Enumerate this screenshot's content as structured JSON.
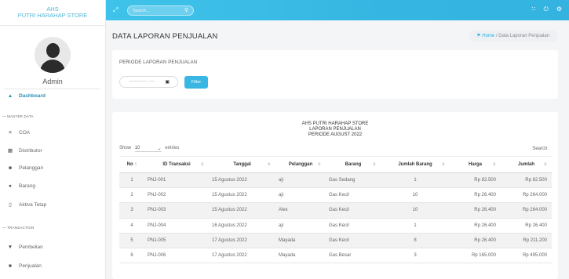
{
  "brand": {
    "line1": "AHS",
    "line2": "PUTRI HARAHAP STORE"
  },
  "user": {
    "name": "Admin"
  },
  "sidebar": {
    "dashboard": "Dashboard",
    "section_master": "MASTER DATA",
    "coa": "COA",
    "distributor": "Distributor",
    "pelanggan": "Pelanggan",
    "barang": "Barang",
    "aktiva": "Aktiva Tetap",
    "section_transaction": "TRANSACTION",
    "pembelian": "Pembelian",
    "penjualan": "Penjualan"
  },
  "topbar": {
    "search_placeholder": "Search..."
  },
  "page": {
    "title": "DATA LAPORAN PENJUALAN",
    "breadcrumb_home": "Home",
    "breadcrumb_sep": "/",
    "breadcrumb_current": "Data Laporan Penjualan"
  },
  "filter": {
    "label": "PERIODE LAPORAN PENJUALAN",
    "date_placeholder": "---------- ----",
    "button": "Filter"
  },
  "report": {
    "store": "AHS PUTRI HARAHAP STORE",
    "title": "LAPORAN PENJUALAN",
    "period": "PERIODE AUGUST 2022"
  },
  "table_controls": {
    "show": "Show",
    "entries_value": "10",
    "entries": "entries",
    "search": "Search:"
  },
  "columns": [
    "No",
    "ID Transaksi",
    "Tanggal",
    "Pelanggan",
    "Barang",
    "Jumlah Barang",
    "Harga",
    "Jumlah"
  ],
  "rows": [
    [
      "1",
      "PNJ-001",
      "15 Agustus 2022",
      "aji",
      "Gas Sedang",
      "1",
      "Rp 82.500",
      "Rp 82.500"
    ],
    [
      "2",
      "PNJ-002",
      "15 Agustus 2022",
      "aji",
      "Gas Kecil",
      "10",
      "Rp 26.400",
      "Rp 264.000"
    ],
    [
      "3",
      "PNJ-003",
      "15 Agustus 2022",
      "Alex",
      "Gas Kecil",
      "10",
      "Rp 26.400",
      "Rp 264.000"
    ],
    [
      "4",
      "PNJ-004",
      "16 Agustus 2022",
      "aji",
      "Gas Kecil",
      "1",
      "Rp 26.400",
      "Rp 26.400"
    ],
    [
      "5",
      "PNJ-005",
      "17 Agustus 2022",
      "Mayada",
      "Gas Kecil",
      "8",
      "Rp 26.400",
      "Rp 211.200"
    ],
    [
      "6",
      "PNJ-006",
      "17 Agustus 2022",
      "Mayada",
      "Gas Besar",
      "3",
      "Rp 165.000",
      "Rp 495.000"
    ]
  ]
}
